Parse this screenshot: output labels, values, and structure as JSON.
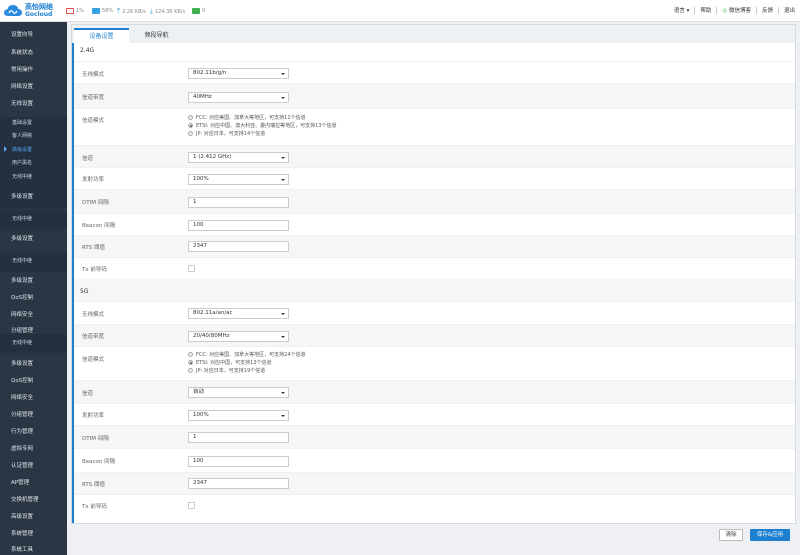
{
  "brand": {
    "name_cn": "高怡网络",
    "name_en": "Gocloud"
  },
  "status": {
    "cpu": "1%",
    "memory": "58%",
    "upload": "2.26 KB/s",
    "download": "124.36 KB/s",
    "clients": "0"
  },
  "topnav": {
    "language": "语言",
    "help": "帮助",
    "wechat": "微信博客",
    "feedback": "反馈",
    "logout": "退出"
  },
  "sidebar": {
    "items": [
      "设置向导",
      "系统状态",
      "常用操作",
      "网络设置",
      "无线设置",
      "基础设置",
      "客人网络",
      "高级设置",
      "用户黑名",
      "无线中继",
      "多级设置",
      "无线中继",
      "多级设置",
      "无线中继",
      "多级设置",
      "QoS控制",
      "网络安全",
      "分组管理",
      "无线中继",
      "多级设置",
      "QoS控制",
      "网络安全",
      "分组管理",
      "行为管理",
      "虚拟专网",
      "认证管理",
      "AP管理",
      "交换机管理",
      "高级设置",
      "系统管理",
      "系统工具"
    ],
    "active_index": 7
  },
  "tabs": [
    "设备设置",
    "频段导航"
  ],
  "band24": {
    "title": "2.4G",
    "mode_label": "无线模式",
    "mode_value": "802.11b/g/n",
    "bandwidth_label": "信道带宽",
    "bandwidth_value": "40MHz",
    "channel_mode_label": "信道模式",
    "channel_mode_options": [
      "FCC: 对应美国、加拿大等地区，可支持11个信道",
      "ETSI: 对应中国、澳大利亚、委内瑞拉等地区，可支持13个信道",
      "JP: 对应日本，可支持14个信道"
    ],
    "channel_mode_selected": 1,
    "channel_label": "信道",
    "channel_value": "1 (2.412 GHz)",
    "power_label": "发射功率",
    "power_value": "100%",
    "dtim_label": "DTIM 间隔",
    "dtim_value": "1",
    "beacon_label": "Beacon 间隔",
    "beacon_value": "100",
    "rts_label": "RTS 阈值",
    "rts_value": "2347",
    "tx_label": "Tx 前导码",
    "tx_checked": false
  },
  "band5": {
    "title": "5G",
    "mode_label": "无线模式",
    "mode_value": "802.11a/an/ac",
    "bandwidth_label": "信道带宽",
    "bandwidth_value": "20/40/80MHz",
    "channel_mode_label": "信道模式",
    "channel_mode_options": [
      "FCC: 对应美国、加拿大等地区，可支持24个信道",
      "ETSI: 对应中国，可支持13个信道",
      "JP: 对应日本，可支持19个信道"
    ],
    "channel_mode_selected": 1,
    "channel_label": "信道",
    "channel_value": "自动",
    "power_label": "发射功率",
    "power_value": "100%",
    "dtim_label": "DTIM 间隔",
    "dtim_value": "1",
    "beacon_label": "Beacon 间隔",
    "beacon_value": "100",
    "rts_label": "RTS 阈值",
    "rts_value": "2347",
    "tx_label": "Tx 前导码",
    "tx_checked": false
  },
  "buttons": {
    "clear": "清除",
    "save": "保存&应用"
  },
  "colors": {
    "accent": "#1c7fd0",
    "sidebar_bg": "#2b3645",
    "page_bg": "#eef0f3"
  }
}
